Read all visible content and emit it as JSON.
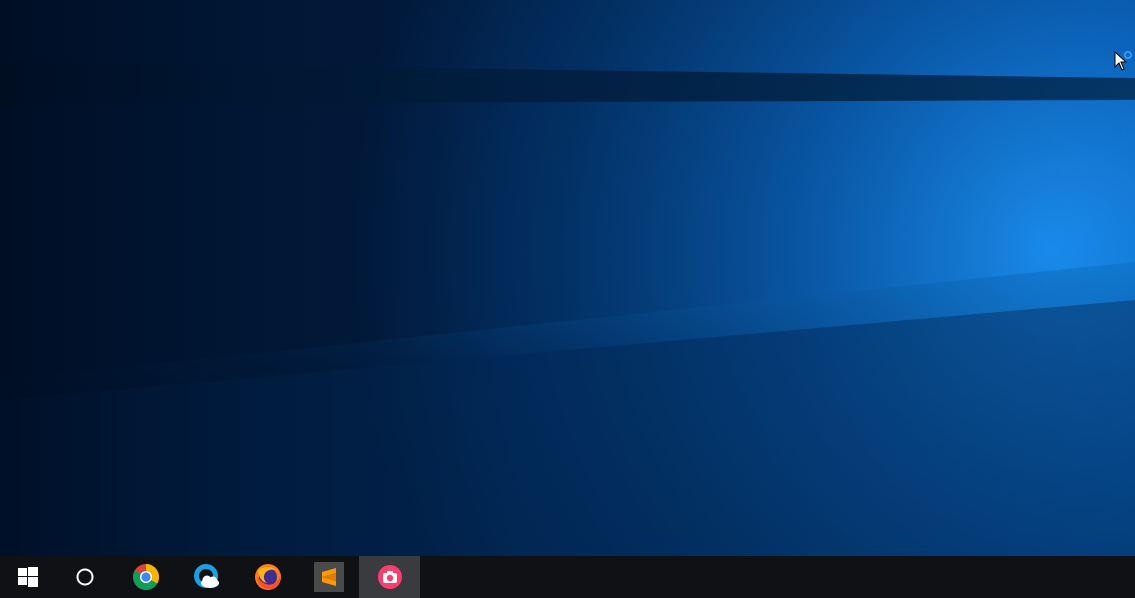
{
  "desktop": {
    "background_color": "#012a57",
    "accent_light": "#0a7fd6"
  },
  "taskbar": {
    "background_color": "#101114",
    "active_highlight": "#3a3b3f",
    "items": [
      {
        "id": "start",
        "icon": "windows-logo-icon"
      },
      {
        "id": "search",
        "icon": "cortana-ring-icon"
      },
      {
        "id": "chrome",
        "icon": "chrome-icon"
      },
      {
        "id": "weather",
        "icon": "weather-cloud-icon"
      },
      {
        "id": "firefox",
        "icon": "firefox-icon"
      },
      {
        "id": "sublime",
        "icon": "sublime-text-icon"
      },
      {
        "id": "camera",
        "icon": "screen-capture-camera-icon",
        "active": true
      }
    ]
  },
  "cursor": {
    "icon": "arrow-busy-cursor-icon"
  }
}
